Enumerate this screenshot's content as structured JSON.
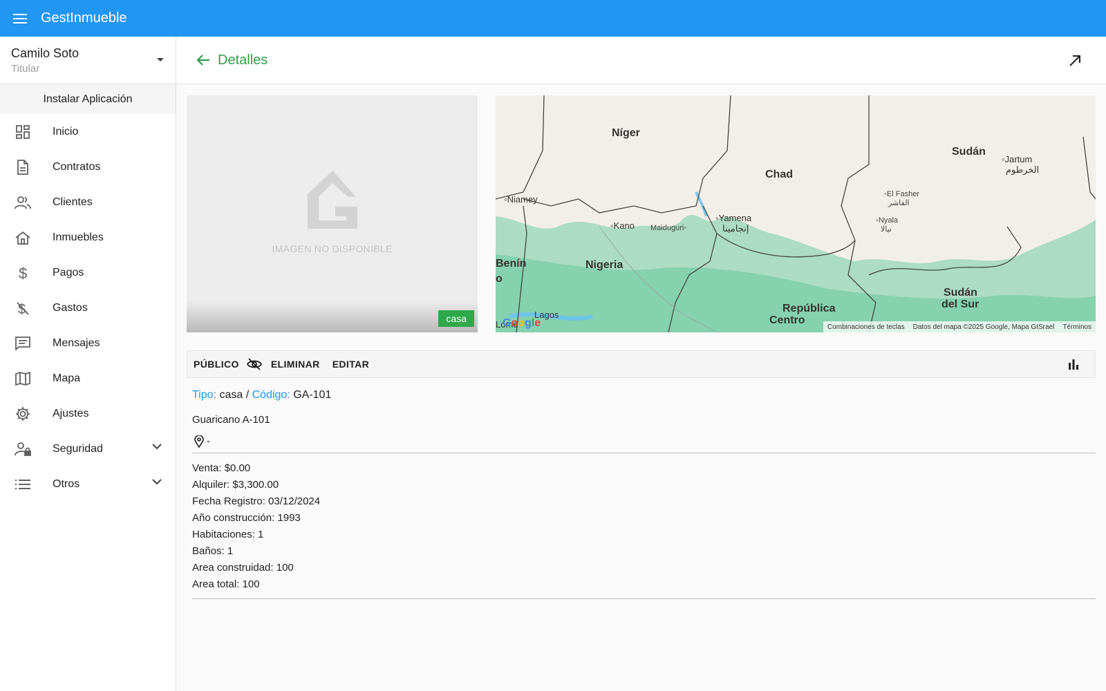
{
  "app": {
    "title": "GestInmueble"
  },
  "account": {
    "name": "Camilo Soto",
    "role": "Titular"
  },
  "sidebar": {
    "install_label": "Instalar Aplicación",
    "items": [
      {
        "label": "Inicio",
        "icon": "dashboard-icon"
      },
      {
        "label": "Contratos",
        "icon": "document-icon"
      },
      {
        "label": "Clientes",
        "icon": "people-icon"
      },
      {
        "label": "Inmuebles",
        "icon": "house-icon"
      },
      {
        "label": "Pagos",
        "icon": "dollar-icon"
      },
      {
        "label": "Gastos",
        "icon": "money-off-icon"
      },
      {
        "label": "Mensajes",
        "icon": "message-icon"
      },
      {
        "label": "Mapa",
        "icon": "map-icon"
      },
      {
        "label": "Ajustes",
        "icon": "gear-icon"
      },
      {
        "label": "Seguridad",
        "icon": "user-lock-icon"
      },
      {
        "label": "Otros",
        "icon": "list-icon"
      }
    ]
  },
  "header": {
    "title": "Detalles"
  },
  "photo": {
    "placeholder_text": "IMAGEN NO DISPONIBLE",
    "tag": "casa"
  },
  "map": {
    "labels": {
      "niger": "Níger",
      "chad": "Chad",
      "sudan": "Sudán",
      "nigeria": "Nigeria",
      "benin": "Benín",
      "sudan_sur_1": "Sudán",
      "sudan_sur_2": "del Sur",
      "rca_1": "República",
      "rca_2": "Centro",
      "niamey": "Niamey",
      "kano": "Kano",
      "maiduguri": "Maiduguri",
      "yamena": "Yamena",
      "yamena_ar": "إنجامينا",
      "jartum": "Jartum",
      "jartum_ar": "الخرطوم",
      "el_fasher": "El Fasher",
      "el_fasher_ar": "الفاشر",
      "nyala": "Nyala",
      "nyala_ar": "نيالا",
      "lagos": "Lagos",
      "lome": "Lomé",
      "o": "o"
    },
    "attribution": {
      "shortcuts": "Combinaciones de teclas",
      "data": "Datos del mapa ©2025 Google, Mapa GISrael",
      "terms": "Términos"
    },
    "logo": "Google"
  },
  "actions": {
    "public": "PÚBLICO",
    "delete": "ELIMINAR",
    "edit": "EDITAR"
  },
  "details": {
    "type_label": "Tipo:",
    "type_value": "casa",
    "separator": "/",
    "code_label": "Código:",
    "code_value": "GA-101",
    "address": "Guaricano A-101",
    "location": "-",
    "props": [
      "Venta: $0.00",
      "Alquiler: $3,300.00",
      "Fecha Registro: 03/12/2024",
      "Año construcción: 1993",
      "Habitaciones: 1",
      "Baños: 1",
      "Area construidad: 100",
      "Area total: 100"
    ]
  },
  "colors": {
    "primary": "#2196f3",
    "accent_green": "#2e9f4a",
    "tag_green": "#2ea84a"
  }
}
